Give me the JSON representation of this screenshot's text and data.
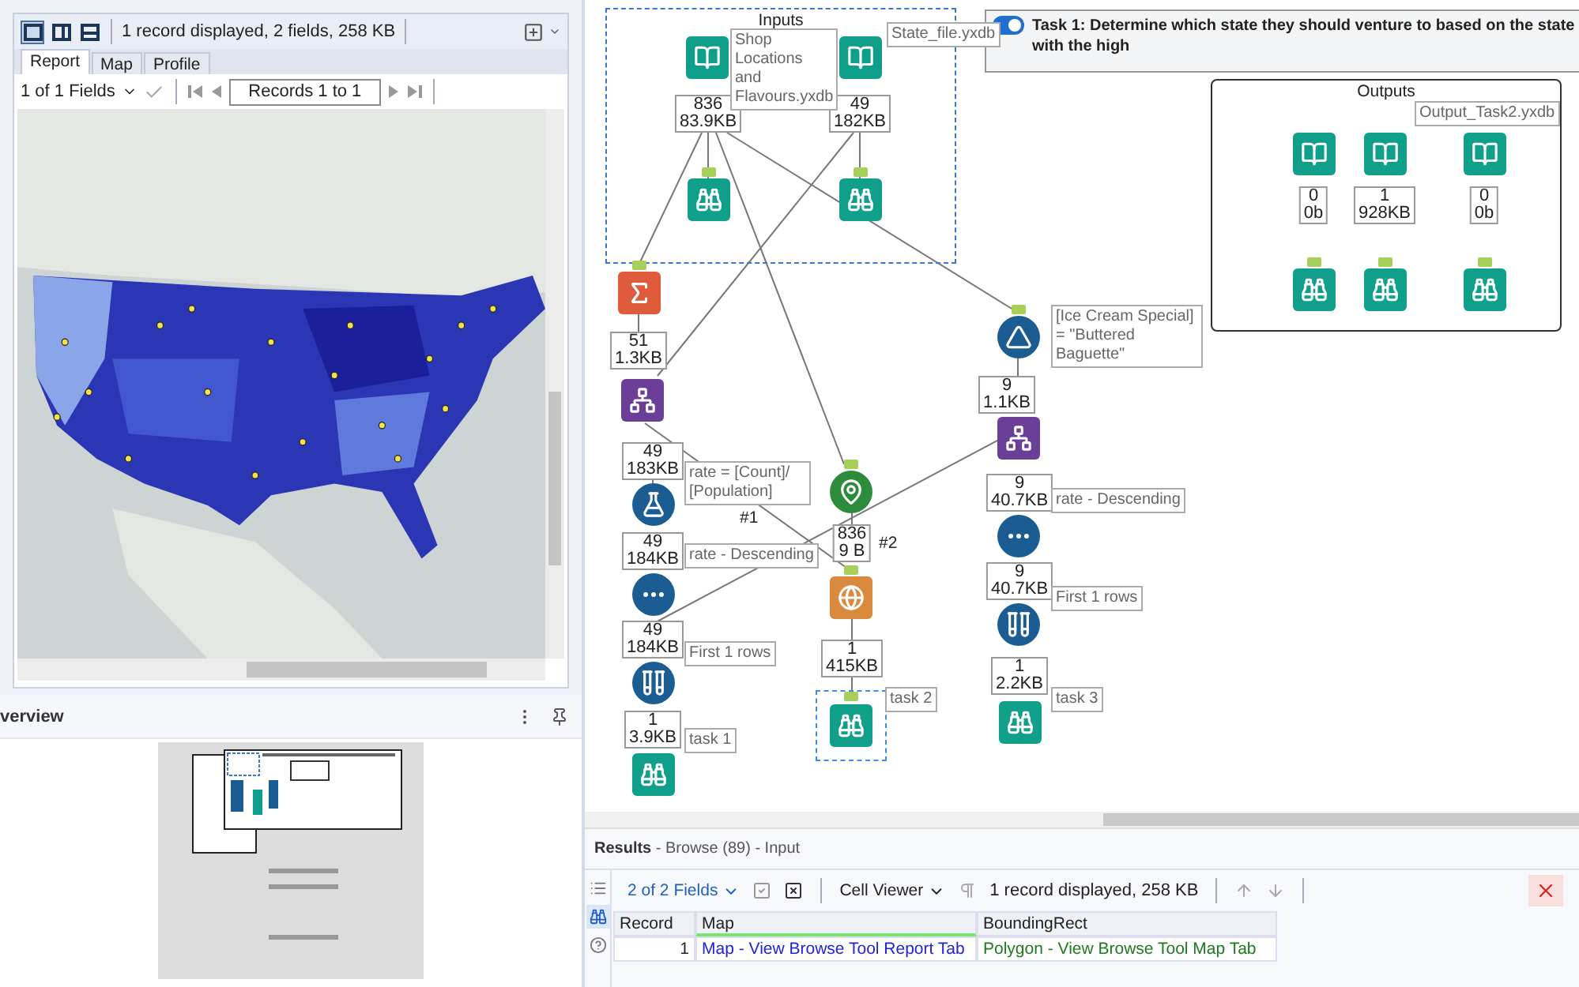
{
  "browse_panel": {
    "layouts": [
      {
        "selected": true
      },
      {
        "selected": false
      },
      {
        "selected": false
      }
    ],
    "status": "1 record displayed, 2 fields, 258 KB",
    "tabs": [
      {
        "label": "Report",
        "selected": true
      },
      {
        "label": "Map",
        "selected": false
      },
      {
        "label": "Profile",
        "selected": false
      }
    ],
    "fields_dropdown": "1 of 1 Fields",
    "records": "Records 1 to 1"
  },
  "overview": {
    "title": "verview"
  },
  "canvas": {
    "containers": [
      {
        "title": "Inputs",
        "kind": "dashed"
      },
      {
        "title": "Outputs",
        "kind": "solid"
      }
    ],
    "comment": {
      "text": "Task 1: Determine which state they should venture to based on the state with the high",
      "on": true
    },
    "tools": [
      {
        "kind": "input",
        "count": "836",
        "size": "83.9KB",
        "selected": false
      },
      {
        "kind": "browse",
        "selected": false
      },
      {
        "kind": "input",
        "count": "49",
        "size": "182KB",
        "selected": false
      },
      {
        "kind": "browse",
        "selected": false
      },
      {
        "kind": "output",
        "count": "0",
        "size": "0b",
        "selected": false
      },
      {
        "kind": "browse",
        "selected": false
      },
      {
        "kind": "output",
        "count": "1",
        "size": "928KB",
        "selected": false
      },
      {
        "kind": "browse",
        "selected": false
      },
      {
        "kind": "output",
        "count": "0",
        "size": "0b",
        "selected": false
      },
      {
        "kind": "browse",
        "selected": false
      },
      {
        "kind": "summarize",
        "count": "51",
        "size": "1.3KB",
        "selected": false
      },
      {
        "kind": "join",
        "count": "49",
        "size": "183KB",
        "selected": false
      },
      {
        "kind": "formula",
        "count": "49",
        "size": "184KB",
        "selected": false
      },
      {
        "kind": "sort",
        "count": "49",
        "size": "184KB",
        "selected": false
      },
      {
        "kind": "sample",
        "count": "1",
        "size": "3.9KB",
        "selected": false
      },
      {
        "kind": "browse",
        "selected": false
      },
      {
        "kind": "spatial",
        "count": "836",
        "size": "9 B",
        "selected": false
      },
      {
        "kind": "report",
        "count": "1",
        "size": "415KB",
        "selected": false
      },
      {
        "kind": "browse",
        "selected": true
      },
      {
        "kind": "filter",
        "count": "9",
        "size": "1.1KB",
        "selected": false
      },
      {
        "kind": "join",
        "count": "9",
        "size": "40.7KB",
        "selected": false
      },
      {
        "kind": "sort",
        "count": "9",
        "size": "40.7KB",
        "selected": false
      },
      {
        "kind": "sample",
        "count": "1",
        "size": "2.2KB",
        "selected": false
      },
      {
        "kind": "browse",
        "selected": false
      }
    ],
    "annotations": [
      "Shop Locations and Flavours.yxdb",
      "State_file.yxdb",
      "Output_Task2.yxdb",
      "rate = [Count]/ [Population]",
      "rate - Descending",
      "First 1 rows",
      "task 1",
      "[Ice Cream Special] = \"Buttered Baguette\"",
      "rate - Descending",
      "First 1 rows",
      "task 2",
      "task 3"
    ],
    "connection_labels": [
      "#1",
      "#2"
    ]
  },
  "results": {
    "title": "Results",
    "subtitle": " - Browse (89) - Input",
    "side_tabs": [
      {
        "selected": false
      },
      {
        "selected": true
      },
      {
        "selected": false
      }
    ],
    "fields_dropdown": "2 of 2 Fields",
    "viewer_dropdown": "Cell Viewer",
    "status": "1 record displayed, 258 KB",
    "columns": [
      "Record",
      "Map",
      "BoundingRect"
    ],
    "rows": [
      [
        "1",
        "Map - View Browse Tool Report Tab",
        "Polygon - View Browse Tool Map Tab"
      ]
    ]
  }
}
